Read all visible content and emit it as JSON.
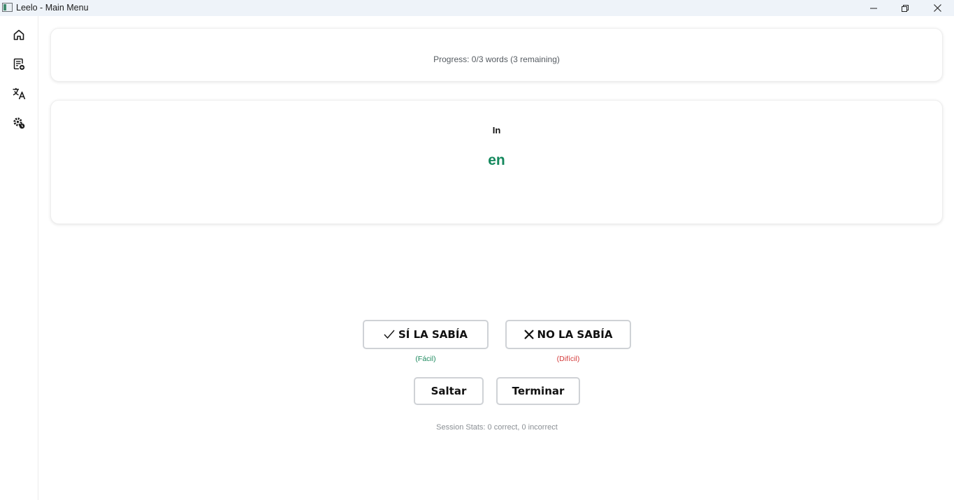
{
  "window": {
    "title": "Leelo - Main Menu"
  },
  "sidebar": {
    "items": [
      {
        "icon": "home-icon"
      },
      {
        "icon": "list-add-icon"
      },
      {
        "icon": "translate-icon"
      },
      {
        "icon": "settings-icon"
      }
    ]
  },
  "progress": {
    "text": "Progress: 0/3 words (3 remaining)"
  },
  "card": {
    "source_word": "In",
    "translation": "en",
    "translation_color": "#14885d"
  },
  "actions": {
    "knew_label": "SÍ LA SABÍA",
    "knew_hint": "(Fácil)",
    "unknown_label": "NO LA SABÍA",
    "unknown_hint": "(Difícil)",
    "skip_label": "Saltar",
    "finish_label": "Terminar"
  },
  "stats": {
    "text": "Session Stats: 0 correct, 0 incorrect"
  },
  "colors": {
    "easy": "#1e8a5f",
    "hard": "#d43a3a"
  }
}
